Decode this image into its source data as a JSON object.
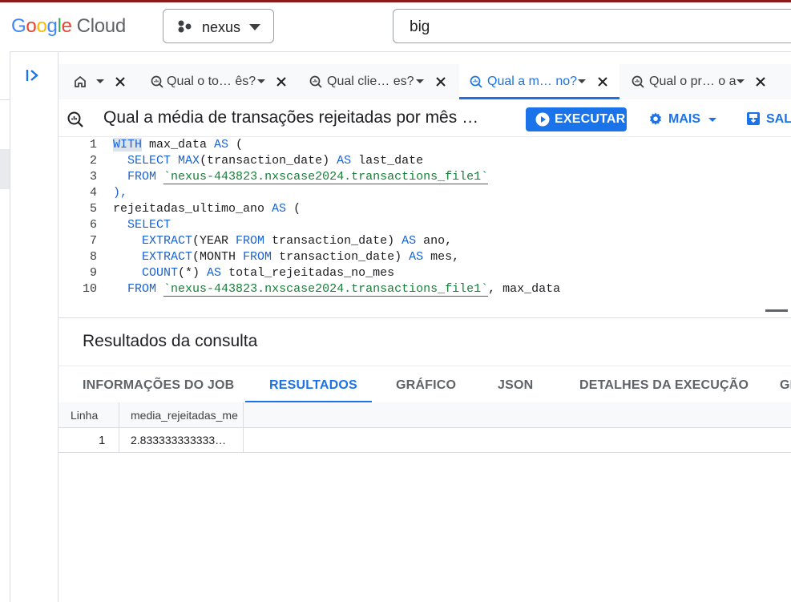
{
  "brand": {
    "google": "Google",
    "cloud": "Cloud",
    "colors": [
      "#4285f4",
      "#ea4335",
      "#fbbc05",
      "#4285f4",
      "#34a853",
      "#ea4335"
    ]
  },
  "project": {
    "name": "nexus"
  },
  "search": {
    "value": "big"
  },
  "tabs": [
    {
      "label": "",
      "icon": "home-icon"
    },
    {
      "label": "Qual o to… ês?",
      "icon": "query-icon"
    },
    {
      "label": "Qual clie… es?",
      "icon": "query-icon"
    },
    {
      "label": "Qual a m… no?",
      "icon": "query-icon",
      "active": true
    },
    {
      "label": "Qual o pr… o a",
      "icon": "query-icon"
    }
  ],
  "query": {
    "title": "Qual a média de transações rejeitadas por mês …",
    "run_label": "EXECUTAR",
    "more_label": "MAIS",
    "save_label": "SALV"
  },
  "editor": {
    "line_numbers": [
      "1",
      "2",
      "3",
      "4",
      "5",
      "6",
      "7",
      "8",
      "9",
      "10"
    ]
  },
  "results": {
    "heading": "Resultados da consulta",
    "tabs": [
      "INFORMAÇÕES DO JOB",
      "RESULTADOS",
      "GRÁFICO",
      "JSON",
      "DETALHES DA EXECUÇÃO",
      "GI"
    ],
    "active_tab": "RESULTADOS",
    "columns": [
      "Linha",
      "media_rejeitadas_me"
    ],
    "rows": [
      [
        "1",
        "2.833333333333…"
      ]
    ]
  },
  "colors": {
    "accent": "#1a73e8",
    "string": "#188038",
    "keyword": "#1a63d6"
  }
}
